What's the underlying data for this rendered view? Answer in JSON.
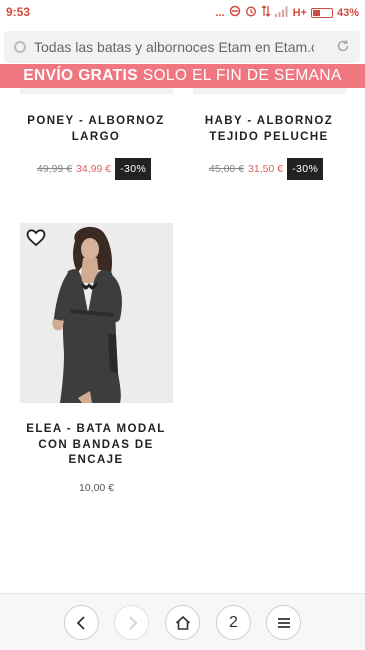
{
  "status_bar": {
    "time": "9:53",
    "dots": "...",
    "network": "H+",
    "battery": "43%",
    "battery_level": 0.43
  },
  "browser": {
    "url_text": "Todas las batas y albornoces Etam en Etam.c"
  },
  "promo": {
    "bold": "ENVÍO GRATIS",
    "rest": " SOLO EL FIN DE SEMANA"
  },
  "products": [
    {
      "name": "PONEY - ALBORNOZ LARGO",
      "old_price": "49,99 €",
      "new_price": "34,99 €",
      "discount": "-30%"
    },
    {
      "name": "HABY - ALBORNOZ TEJIDO PELUCHE",
      "old_price": "45,00 €",
      "new_price": "31,50 €",
      "discount": "-30%"
    },
    {
      "name": "ELEA - BATA MODAL CON BANDAS DE ENCAJE",
      "price": "10,00 €"
    }
  ],
  "bottom_nav": {
    "tab_count": "2",
    "icons": [
      "chevron-left-icon",
      "chevron-right-icon",
      "home-icon",
      "tabs-icon",
      "menu-icon"
    ]
  },
  "colors": {
    "promo_bg": "#f07680",
    "sale_price": "#e06060",
    "discount_bg": "#222222",
    "status": "#d24a3e"
  }
}
